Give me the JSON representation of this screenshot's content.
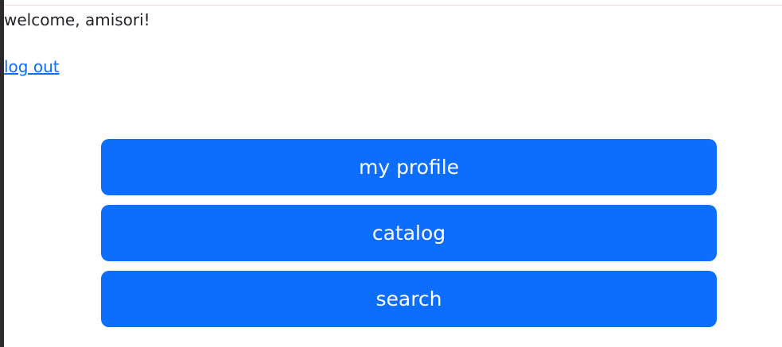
{
  "header": {
    "welcome_text": "welcome, amisori!",
    "logout_label": "log out"
  },
  "menu": {
    "items": [
      {
        "label": "my profile"
      },
      {
        "label": "catalog"
      },
      {
        "label": "search"
      }
    ]
  },
  "colors": {
    "primary": "#0d6efd",
    "text": "#212529",
    "link": "#0d6efd",
    "button_text": "#ffffff"
  }
}
